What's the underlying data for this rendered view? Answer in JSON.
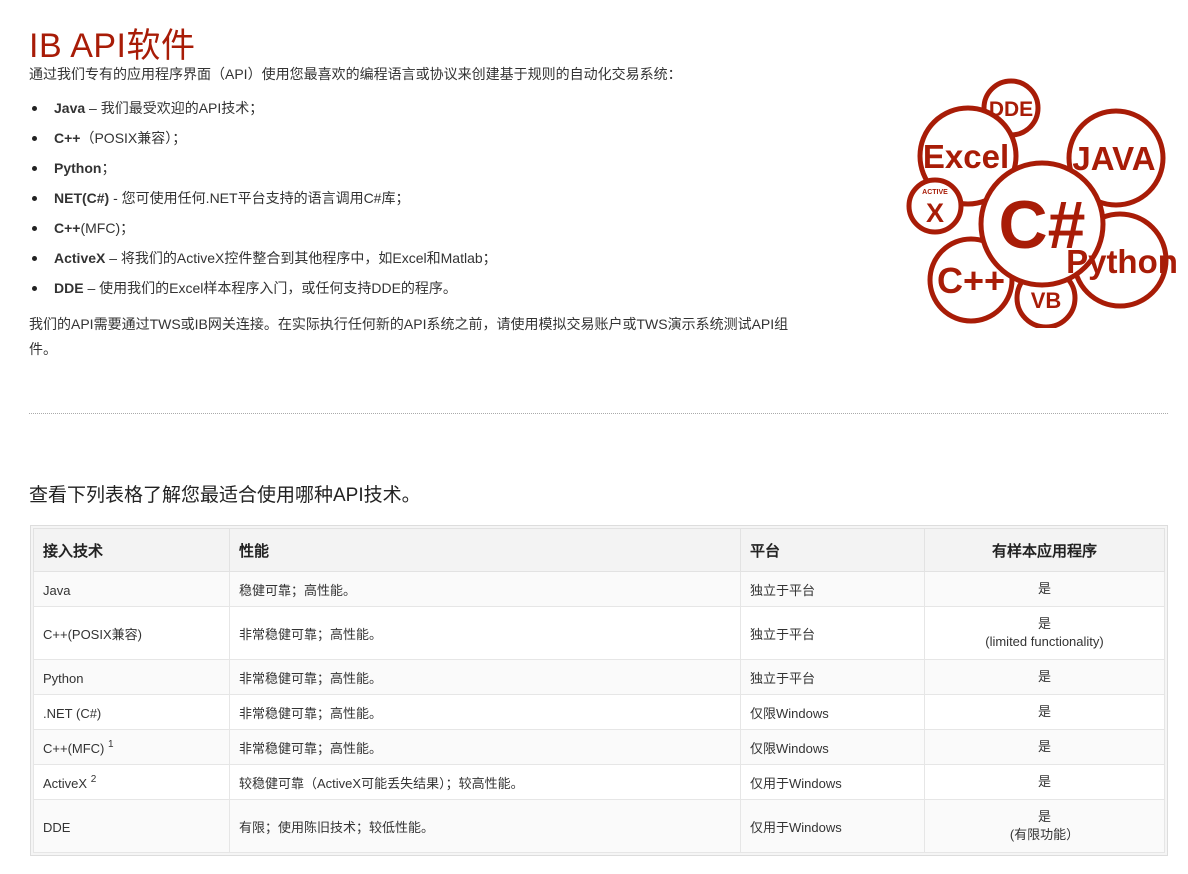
{
  "page": {
    "title": "IB API软件",
    "intro": "通过我们专有的应用程序界面（API）使用您最喜欢的编程语言或协议来创建基于规则的自动化交易系统："
  },
  "api_list": [
    {
      "name": "Java",
      "desc": " – 我们最受欢迎的API技术；"
    },
    {
      "name": "C++",
      "desc": "（POSIX兼容）；"
    },
    {
      "name": "Python",
      "desc": "；"
    },
    {
      "name": "NET(C#)",
      "desc": " - 您可使用任何.NET平台支持的语言调用C#库；"
    },
    {
      "name": "C++",
      "desc": "(MFC)；"
    },
    {
      "name": "ActiveX",
      "desc": " – 将我们的ActiveX控件整合到其他程序中，如Excel和Matlab；"
    },
    {
      "name": "DDE",
      "desc": " – 使用我们的Excel样本程序入门，或任何支持DDE的程序。"
    }
  ],
  "note": "我们的API需要通过TWS或IB网关连接。在实际执行任何新的API系统之前，请使用模拟交易账户或TWS演示系统测试API组件。",
  "logo": {
    "labels": [
      "DDE",
      "Excel",
      "JAVA",
      "ACTIVE",
      "X",
      "C#",
      "Python",
      "C++",
      "VB"
    ],
    "color": "#a81c07"
  },
  "table": {
    "caption": "查看下列表格了解您最适合使用哪种API技术。",
    "headers": [
      "接入技术",
      "性能",
      "平台",
      "有样本应用程序"
    ],
    "rows": [
      {
        "tech": "Java",
        "sup": "",
        "perf": "稳健可靠；高性能。",
        "platform": "独立于平台",
        "sample": "是",
        "sample_note": ""
      },
      {
        "tech": "C++(POSIX兼容)",
        "sup": "",
        "perf": "非常稳健可靠；高性能。",
        "platform": "独立于平台",
        "sample": "是",
        "sample_note": "(limited functionality)"
      },
      {
        "tech": "Python",
        "sup": "",
        "perf": "非常稳健可靠；高性能。",
        "platform": "独立于平台",
        "sample": "是",
        "sample_note": ""
      },
      {
        "tech": ".NET (C#)",
        "sup": "",
        "perf": "非常稳健可靠；高性能。",
        "platform": "仅限Windows",
        "sample": "是",
        "sample_note": ""
      },
      {
        "tech": "C++(MFC) ",
        "sup": "1",
        "perf": "非常稳健可靠；高性能。",
        "platform": "仅限Windows",
        "sample": "是",
        "sample_note": ""
      },
      {
        "tech": "ActiveX ",
        "sup": "2",
        "perf": "较稳健可靠（ActiveX可能丢失结果）；较高性能。",
        "platform": "仅用于Windows",
        "sample": "是",
        "sample_note": ""
      },
      {
        "tech": "DDE",
        "sup": "",
        "perf": "有限；使用陈旧技术；较低性能。",
        "platform": "仅用于Windows",
        "sample": "是",
        "sample_note": "(有限功能）"
      }
    ]
  }
}
